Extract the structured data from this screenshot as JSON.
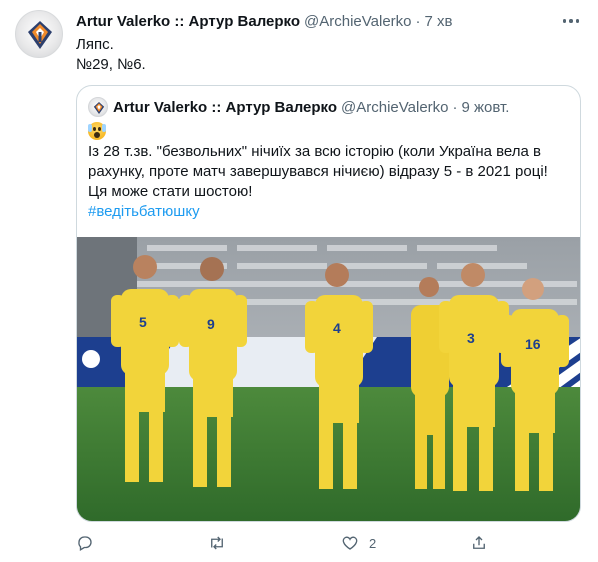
{
  "tweet": {
    "author_name": "Artur Valerko :: Артур Валерко",
    "handle": "@ArchieValerko",
    "separator": "·",
    "time": "7 хв",
    "text_lines": [
      "Ляпс.",
      "№29, №6."
    ],
    "avatar_icon": "brand-logo-icon",
    "more_icon": "more-horizontal-icon"
  },
  "quoted_tweet": {
    "author_name": "Artur Valerko :: Артур Валерко",
    "handle": "@ArchieValerko",
    "separator": "·",
    "time": "9 жовт.",
    "emoji": "scream-emoji-icon",
    "text_lines": [
      "Із 28 т.зв. \"безвольних\" нічиїх за всю історію (коли Україна вела в",
      "рахунку, проте матч завершувався нічиєю) відразу 5 - в 2021 році!",
      "Ця може стати шостою!"
    ],
    "hashtag": "#ведітьбатюшку",
    "photo": {
      "description_icon": "football-team-photo",
      "jersey_numbers": [
        "5",
        "9",
        "4",
        "3",
        "16"
      ]
    }
  },
  "actions": {
    "reply": {
      "icon": "reply-icon",
      "count": ""
    },
    "retweet": {
      "icon": "retweet-icon",
      "count": ""
    },
    "like": {
      "icon": "heart-icon",
      "count": "2"
    },
    "share": {
      "icon": "share-icon",
      "count": ""
    }
  },
  "colors": {
    "text": "#0f1419",
    "secondary": "#536471",
    "link": "#1d9bf0",
    "border": "#cfd9de",
    "jersey": "#f2d43a",
    "pitch": "#3e7a34"
  }
}
